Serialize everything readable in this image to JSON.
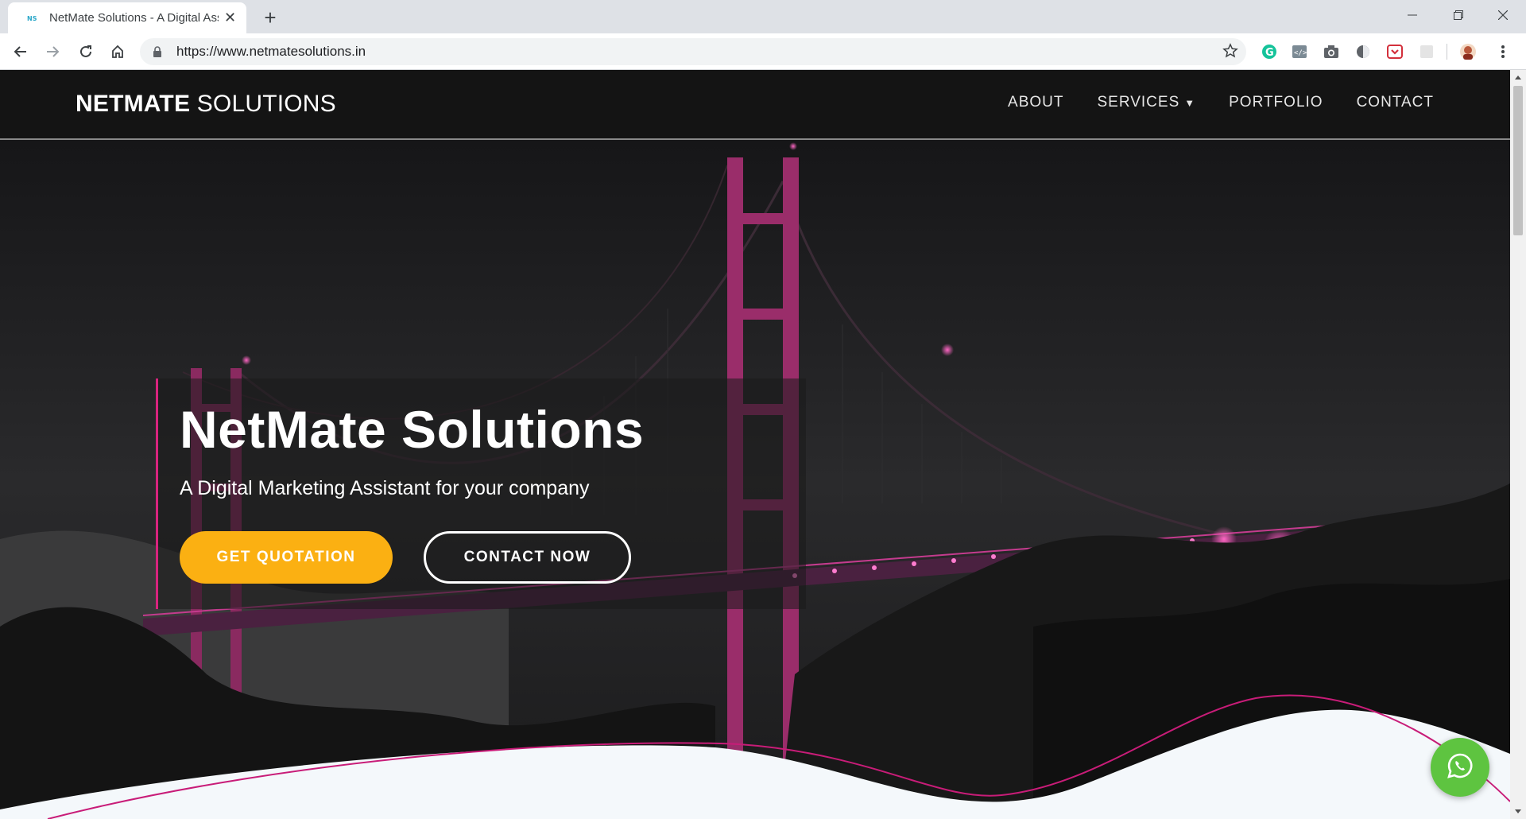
{
  "browser": {
    "tab": {
      "title": "NetMate Solutions - A Digital Assistant",
      "favicon_icon": "nms-logo-icon"
    },
    "url": "https://www.netmatesolutions.in",
    "extensions": [
      "grammarly-icon",
      "code-viewer-icon",
      "camera-icon",
      "dark-reader-icon",
      "pocket-icon",
      "extension-icon",
      "profile-avatar"
    ]
  },
  "site": {
    "brand": {
      "bold": "NETMATE",
      "light": " SOLUTIONS"
    },
    "menu": {
      "about": "ABOUT",
      "services": "SERVICES",
      "portfolio": "PORTFOLIO",
      "contact": "CONTACT"
    },
    "hero": {
      "title": "NetMate Solutions",
      "subtitle": "A Digital Marketing Assistant for your company",
      "primary_button": "GET QUOTATION",
      "secondary_button": "CONTACT NOW"
    },
    "colors": {
      "accent_pink": "#d8247e",
      "button_yellow": "#fbb012",
      "whatsapp_green": "#5ec440"
    }
  }
}
